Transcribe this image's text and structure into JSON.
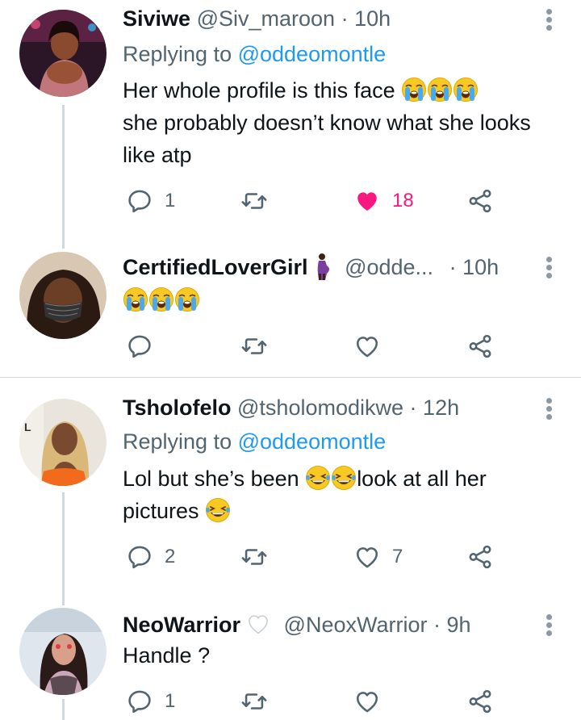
{
  "tweets": [
    {
      "name": "Siviwe",
      "handle": "@Siv_maroon",
      "dot": "·",
      "time": "10h",
      "replying_prefix": "Replying to ",
      "replying_mention": "@oddeomontle",
      "text_line1": "Her whole profile is this face ",
      "text_rest": "she probably doesn’t know what she looks like atp",
      "reply_count": "1",
      "like_count": "18",
      "liked": true
    },
    {
      "name": "CertifiedLoverGirl",
      "handle": "@odde...",
      "dot": "·",
      "time": "10h"
    },
    {
      "name": "Tsholofelo",
      "handle": "@tsholomodikwe",
      "dot": "·",
      "time": "12h",
      "replying_prefix": "Replying to ",
      "replying_mention": "@oddeomontle",
      "text_a": "Lol but she’s been ",
      "text_b": "look at all her",
      "text_c": "pictures ",
      "reply_count": "2",
      "like_count": "7"
    },
    {
      "name": "NeoWarrior",
      "handle": "@NeoxWarrior",
      "dot": "·",
      "time": "9h",
      "text": "Handle ?",
      "reply_count": "1"
    }
  ],
  "colors": {
    "like_pink": "#f91880",
    "mention_blue": "#1d9bf0",
    "secondary_text": "#536471",
    "icon_gray": "#536471"
  },
  "icons": {
    "reply": "reply-icon",
    "retweet": "retweet-icon",
    "like": "heart-icon",
    "share": "share-icon",
    "more": "more-options-icon"
  }
}
